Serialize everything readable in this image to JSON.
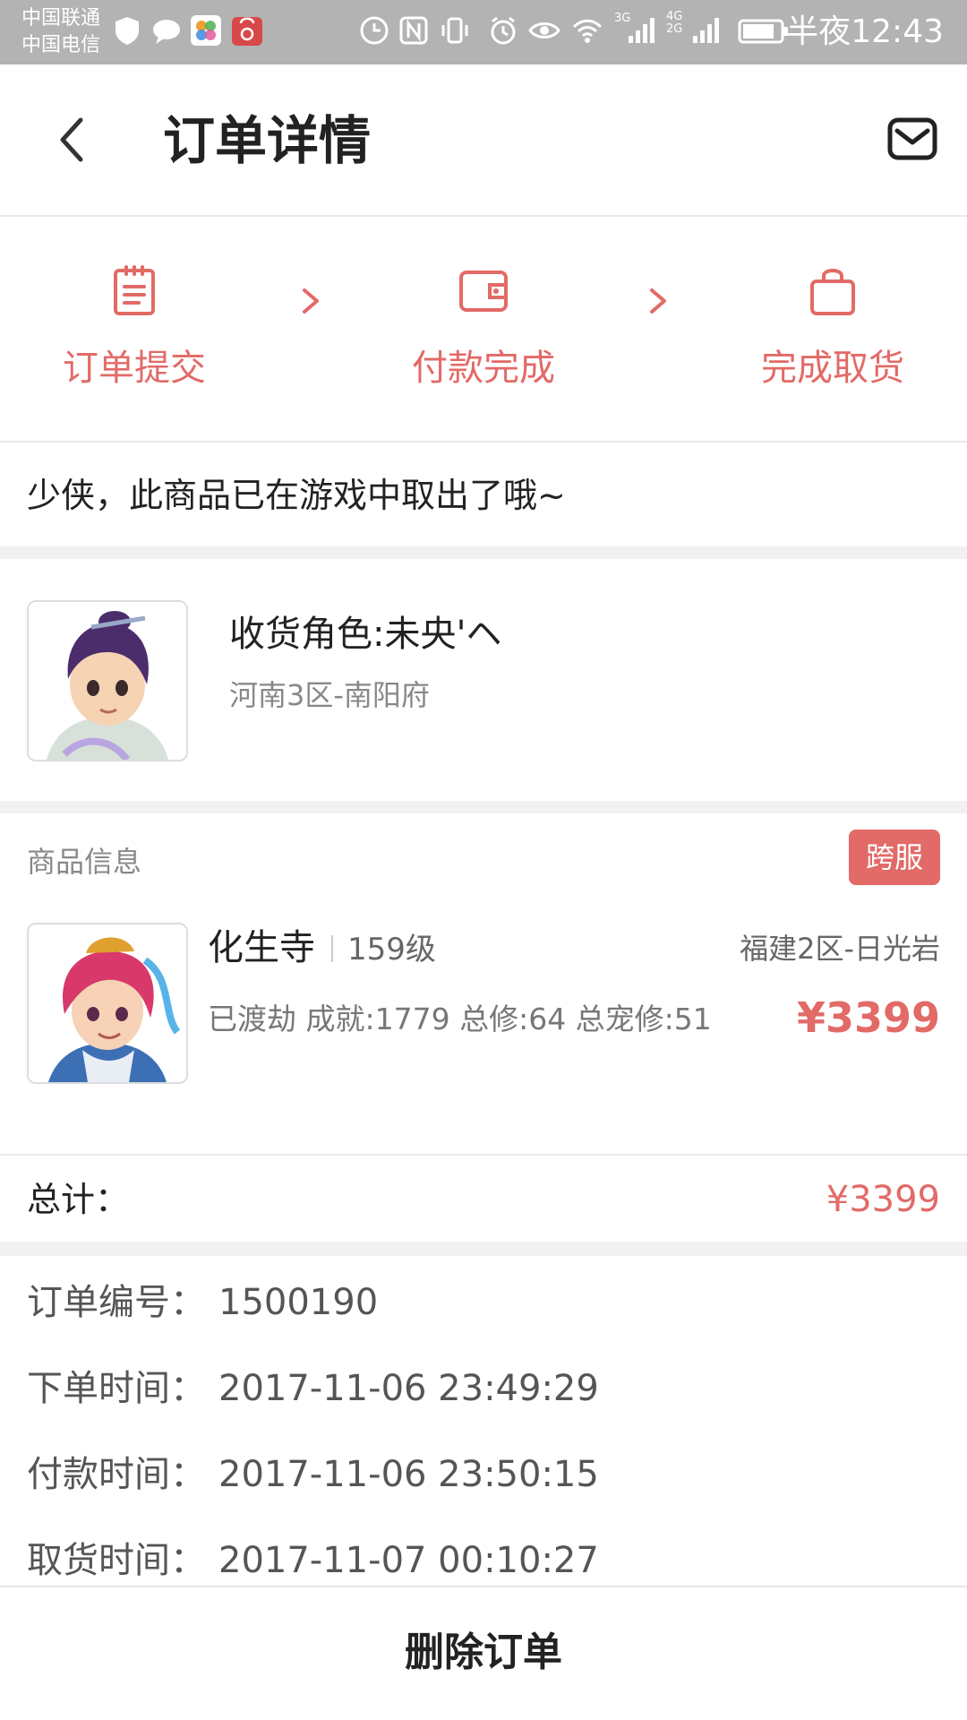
{
  "status_bar": {
    "carrier_1": "中国联通",
    "carrier_2": "中国电信",
    "network_1": "3G",
    "network_2": "4G",
    "network_3": "2G",
    "time": "半夜12:43",
    "icons": [
      "shield-icon",
      "chat-icon",
      "photos-icon",
      "huawei-store-icon",
      "data-saver-icon",
      "nfc-icon",
      "vibrate-icon",
      "alarm-icon",
      "eye-icon",
      "wifi-icon",
      "signal-icon",
      "signal-icon",
      "battery-icon"
    ]
  },
  "nav": {
    "title": "订单详情",
    "back_icon": "chevron-left-icon",
    "mail_icon": "mail-icon"
  },
  "progress": {
    "steps": [
      {
        "label": "订单提交",
        "icon": "clipboard-icon"
      },
      {
        "label": "付款完成",
        "icon": "wallet-icon"
      },
      {
        "label": "完成取货",
        "icon": "shopping-bag-icon"
      }
    ],
    "accent_color": "#e26a67"
  },
  "status_message": "少侠，此商品已在游戏中取出了哦~",
  "receiver": {
    "role": "收货角色:未央'ヘ",
    "server": "河南3区-南阳府"
  },
  "product": {
    "section_title": "商品信息",
    "badge": "跨服",
    "name": "化生寺",
    "level": "159级",
    "server": "福建2区-日光岩",
    "stats": "已渡劫 成就:1779 总修:64 总宠修:51",
    "price": "¥3399"
  },
  "total": {
    "label": "总计：",
    "value": "¥3399"
  },
  "order_info": [
    {
      "label": "订单编号：",
      "value": "1500190"
    },
    {
      "label": "下单时间：",
      "value": "2017-11-06 23:49:29"
    },
    {
      "label": "付款时间：",
      "value": "2017-11-06 23:50:15"
    },
    {
      "label": "取货时间：",
      "value": "2017-11-07 00:10:27"
    }
  ],
  "bottom": {
    "delete_label": "删除订单"
  }
}
